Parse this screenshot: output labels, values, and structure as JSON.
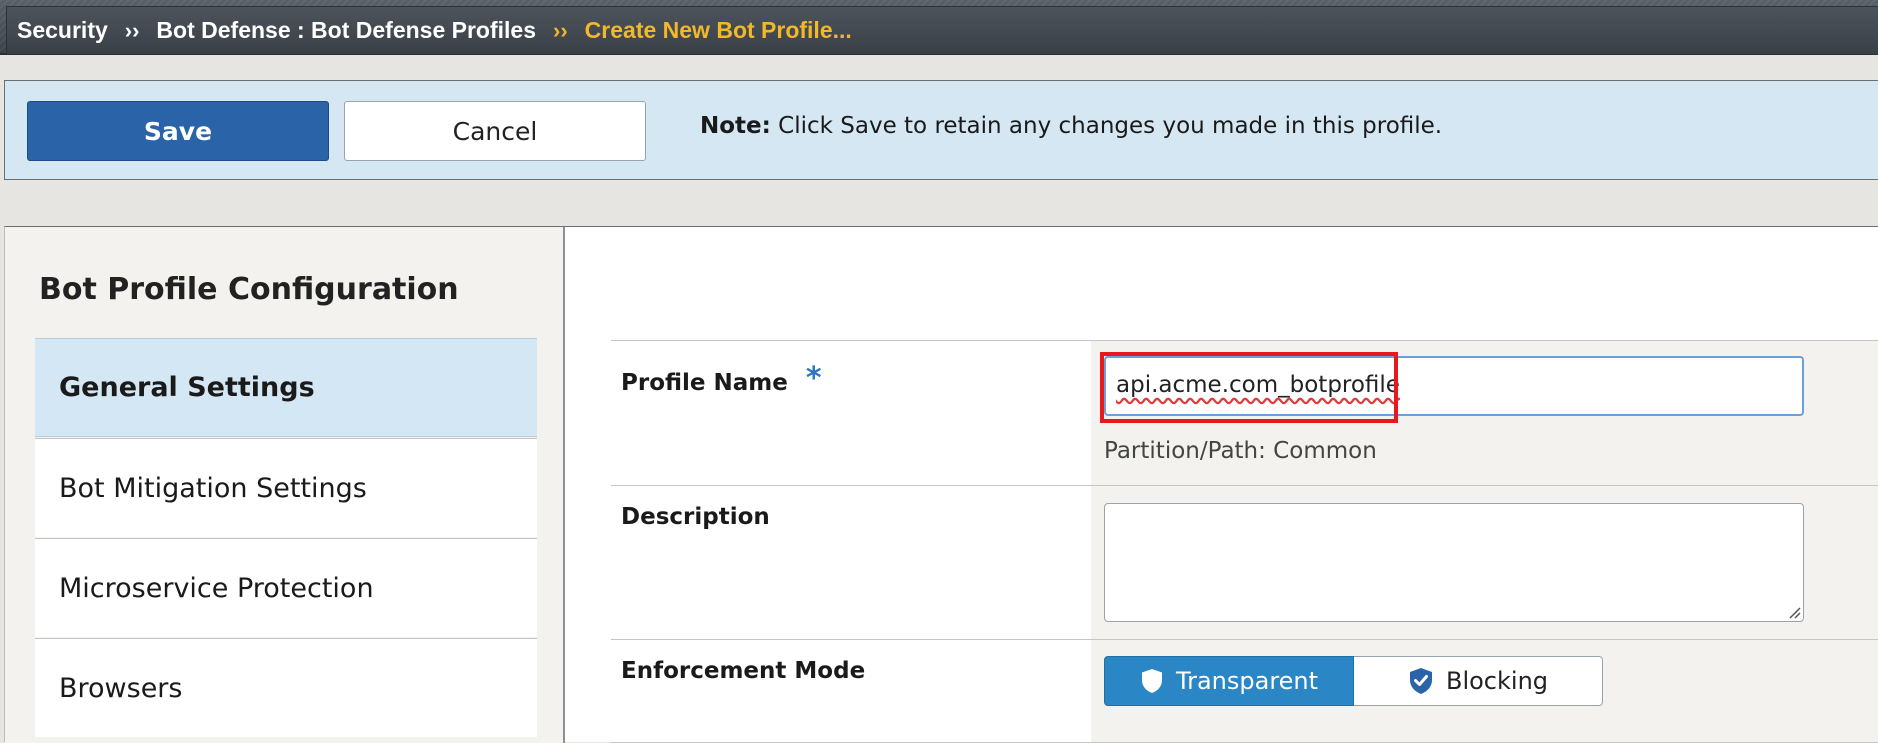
{
  "breadcrumb": {
    "items": [
      "Security",
      "Bot Defense : Bot Defense Profiles"
    ],
    "separator": "››",
    "current": "Create New Bot Profile..."
  },
  "actions": {
    "save_label": "Save",
    "cancel_label": "Cancel",
    "note_label": "Note:",
    "note_text": "Click Save to retain any changes you made in this profile."
  },
  "sidebar": {
    "title": "Bot Profile Configuration",
    "items": [
      {
        "label": "General Settings",
        "active": true
      },
      {
        "label": "Bot Mitigation Settings",
        "active": false
      },
      {
        "label": "Microservice Protection",
        "active": false
      },
      {
        "label": "Browsers",
        "active": false
      }
    ]
  },
  "form": {
    "profile_name": {
      "label": "Profile Name",
      "required_mark": "*",
      "value": "api.acme.com_botprofile",
      "partition_text": "Partition/Path: Common"
    },
    "description": {
      "label": "Description",
      "value": ""
    },
    "enforcement_mode": {
      "label": "Enforcement Mode",
      "options": [
        "Transparent",
        "Blocking"
      ],
      "selected": "Transparent"
    }
  },
  "colors": {
    "accent": "#2b63a8",
    "segment_selected": "#2b86c6",
    "breadcrumb_current": "#f2b82a",
    "highlight_box": "#e8181f"
  }
}
